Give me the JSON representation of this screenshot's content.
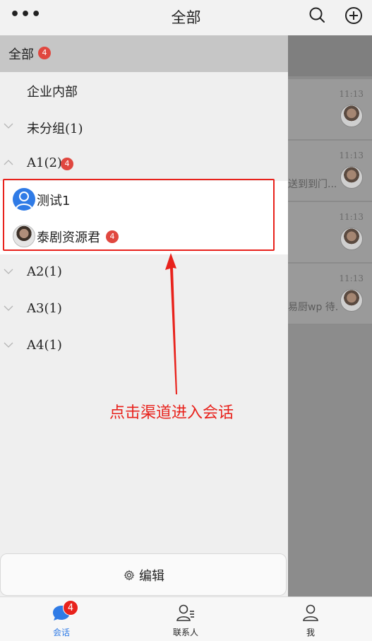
{
  "header": {
    "title": "全部",
    "more_icon": "more-dots-icon",
    "search_icon": "search-icon",
    "add_icon": "add-circle-icon"
  },
  "drawer": {
    "all": {
      "label": "全部",
      "badge": "4"
    },
    "groups": [
      {
        "label": "企业内部",
        "expanded": false,
        "has_chevron": false
      },
      {
        "label": "未分组(1)",
        "expanded": false
      },
      {
        "label": "A1(2)",
        "expanded": true,
        "badge": "4"
      },
      {
        "label": "A2(1)",
        "expanded": false
      },
      {
        "label": "A3(1)",
        "expanded": false
      },
      {
        "label": "A4(1)",
        "expanded": false
      }
    ],
    "channels": [
      {
        "name": "测试1",
        "avatar": "user-avatar-icon"
      },
      {
        "name": "泰剧资源君",
        "avatar": "photo-avatar",
        "badge": "4"
      }
    ],
    "edit": {
      "label": "编辑",
      "icon": "gear-icon"
    }
  },
  "conversations": [
    {
      "time": "11:13",
      "preview": ""
    },
    {
      "time": "11:13",
      "preview": "送到到门..."
    },
    {
      "time": "11:13",
      "preview": ""
    },
    {
      "time": "11:13",
      "preview": "易厨wp 待..."
    }
  ],
  "annotation": {
    "text": "点击渠道进入会话",
    "color": "#e8221c"
  },
  "tabbar": {
    "tabs": [
      {
        "label": "会话",
        "icon": "chat-bubble-icon",
        "active": true,
        "badge": "4"
      },
      {
        "label": "联系人",
        "icon": "contacts-icon",
        "active": false
      },
      {
        "label": "我",
        "icon": "person-icon",
        "active": false
      }
    ]
  },
  "colors": {
    "accent": "#2f7be6",
    "badge": "#e0473f",
    "highlight": "#e8221c"
  }
}
